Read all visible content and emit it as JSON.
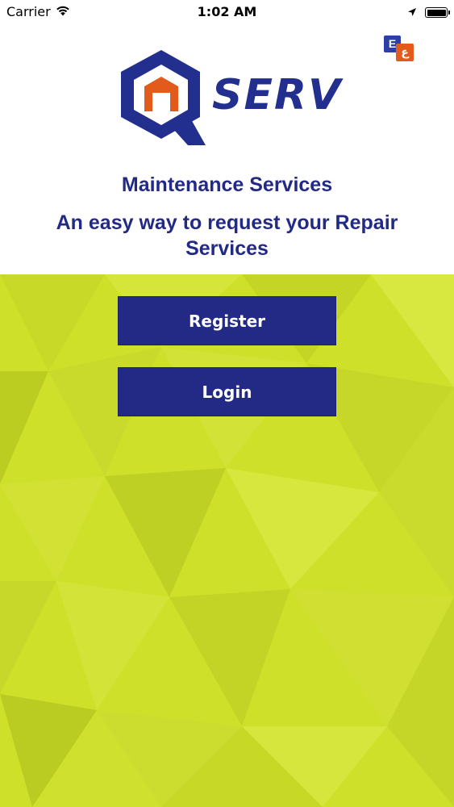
{
  "status_bar": {
    "carrier": "Carrier",
    "time": "1:02 AM"
  },
  "header": {
    "lang_en": "E",
    "lang_ar": "ع",
    "logo_text": "SERV",
    "headline": "Maintenance Services",
    "tagline": "An easy way to request your Repair Services"
  },
  "actions": {
    "register_label": "Register",
    "login_label": "Login"
  },
  "colors": {
    "brand_blue": "#232a86",
    "brand_orange": "#e25a1c",
    "background_lime": "#cfe02a"
  }
}
